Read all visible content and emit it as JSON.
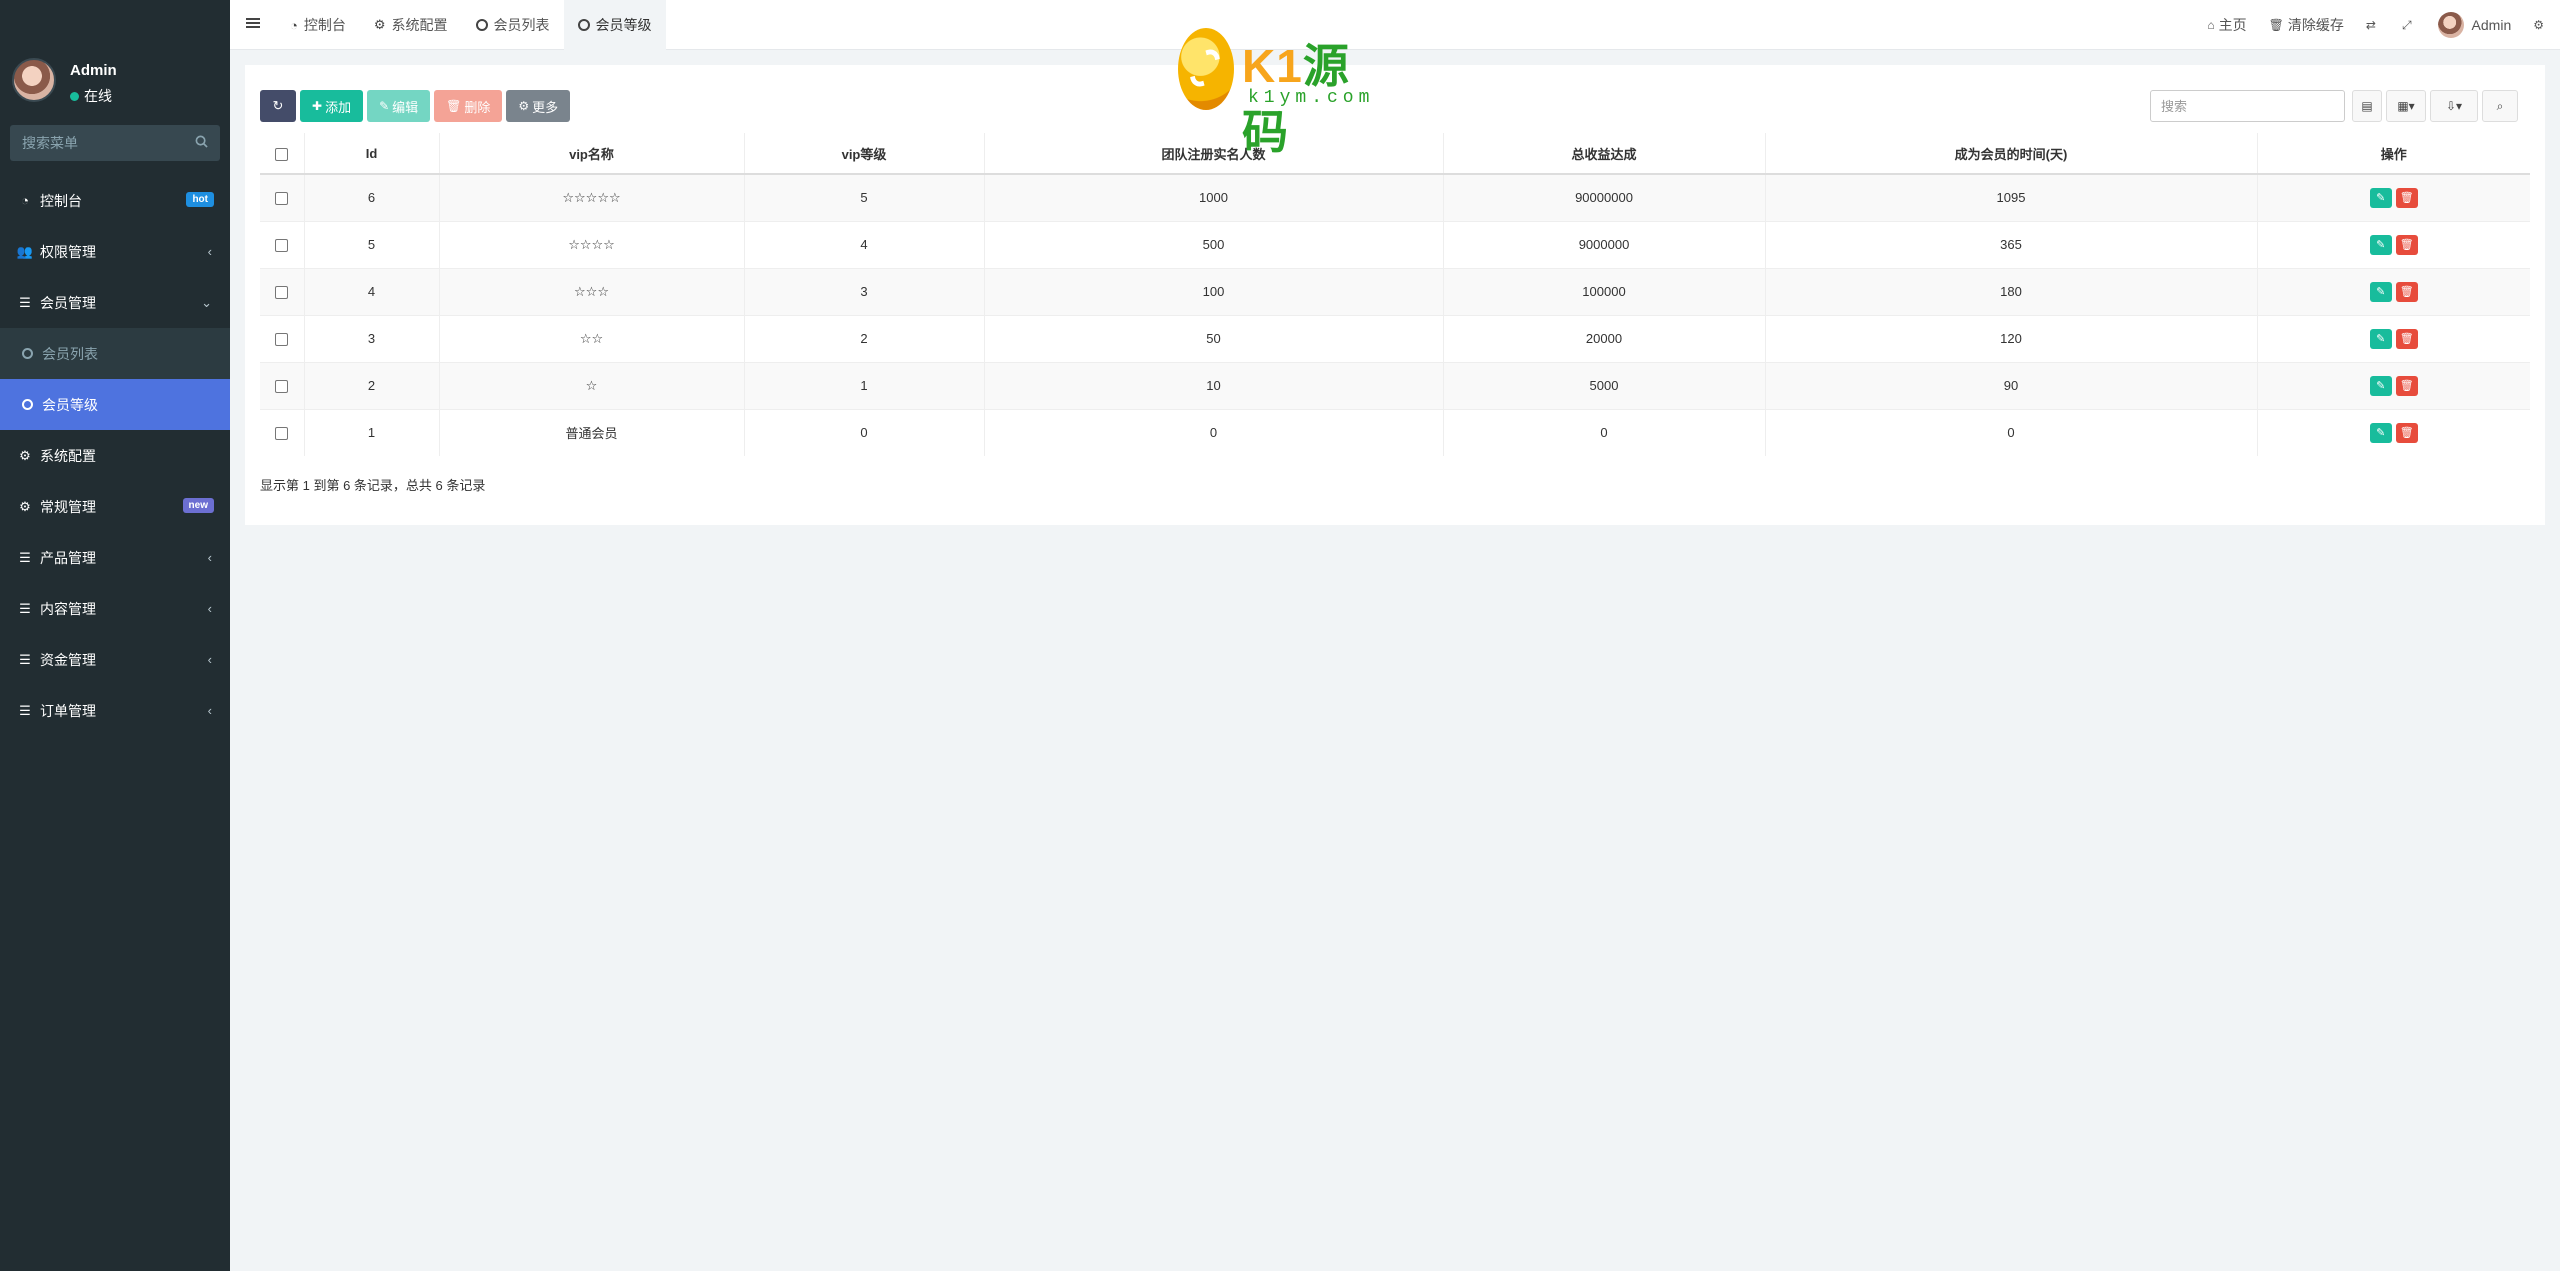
{
  "sidebar": {
    "user": {
      "name": "Admin",
      "status": "在线"
    },
    "search_placeholder": "搜索菜单",
    "items": [
      {
        "label": "控制台",
        "icon": "dashboard-icon",
        "badge": "hot"
      },
      {
        "label": "权限管理",
        "icon": "group-icon"
      },
      {
        "label": "会员管理",
        "icon": "list-icon"
      },
      {
        "label": "会员列表",
        "icon": "circle-icon"
      },
      {
        "label": "会员等级",
        "icon": "circle-icon"
      },
      {
        "label": "系统配置",
        "icon": "gear-icon"
      },
      {
        "label": "常规管理",
        "icon": "gears-icon",
        "badge": "new"
      },
      {
        "label": "产品管理",
        "icon": "list-icon"
      },
      {
        "label": "内容管理",
        "icon": "list-icon"
      },
      {
        "label": "资金管理",
        "icon": "list-icon"
      },
      {
        "label": "订单管理",
        "icon": "list-icon"
      }
    ]
  },
  "topbar": {
    "tabs": [
      {
        "label": "控制台",
        "icon": "dashboard-icon"
      },
      {
        "label": "系统配置",
        "icon": "gear-icon"
      },
      {
        "label": "会员列表",
        "icon": "circle-icon"
      },
      {
        "label": "会员等级",
        "icon": "circle-icon"
      }
    ],
    "home": "主页",
    "clear_cache": "清除缓存",
    "user": "Admin"
  },
  "watermark": {
    "brand_k1": "K1",
    "brand_cn": "源码",
    "url": "k1ym.com"
  },
  "toolbar": {
    "add": "添加",
    "edit": "编辑",
    "delete": "删除",
    "more": "更多",
    "search_placeholder": "搜索"
  },
  "table": {
    "columns": [
      "Id",
      "vip名称",
      "vip等级",
      "团队注册实名人数",
      "总收益达成",
      "成为会员的时间(天)",
      "操作"
    ],
    "rows": [
      [
        "6",
        "☆☆☆☆☆",
        "5",
        "1000",
        "90000000",
        "1095"
      ],
      [
        "5",
        "☆☆☆☆",
        "4",
        "500",
        "9000000",
        "365"
      ],
      [
        "4",
        "☆☆☆",
        "3",
        "100",
        "100000",
        "180"
      ],
      [
        "3",
        "☆☆",
        "2",
        "50",
        "20000",
        "120"
      ],
      [
        "2",
        "☆",
        "1",
        "10",
        "5000",
        "90"
      ],
      [
        "1",
        "普通会员",
        "0",
        "0",
        "0",
        "0"
      ]
    ]
  },
  "pagination_info": "显示第 1 到第 6 条记录，总共 6 条记录",
  "colors": {
    "sidebar_bg": "#222d32",
    "active_menu": "#4e73df",
    "success": "#18bc9c",
    "danger": "#e74c3c",
    "hot_badge": "#1e8fe1",
    "new_badge": "#6c6fd2"
  }
}
